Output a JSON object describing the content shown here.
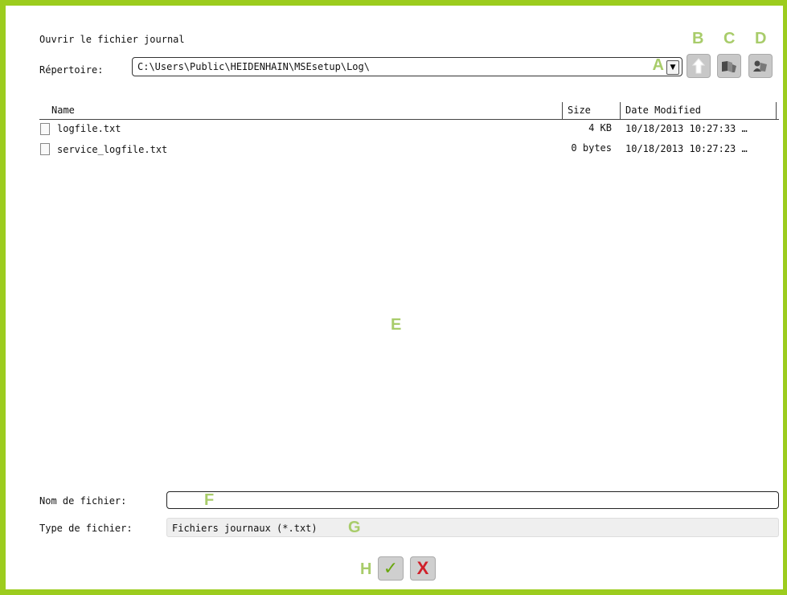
{
  "dialog": {
    "title": "Ouvrir le fichier journal",
    "directory_label": "Répertoire:",
    "directory_value": "C:\\Users\\Public\\HEIDENHAIN\\MSEsetup\\Log\\"
  },
  "callouts": {
    "a": "A",
    "b": "B",
    "c": "C",
    "d": "D",
    "e": "E",
    "f": "F",
    "g": "G",
    "h": "H"
  },
  "toolbar": {
    "icons": [
      "up-folder-icon",
      "browse-folder-icon",
      "network-folder-icon"
    ]
  },
  "file_list": {
    "headers": {
      "name": "Name",
      "size": "Size",
      "date": "Date Modified"
    },
    "rows": [
      {
        "name": "logfile.txt",
        "size": "4 KB",
        "date": "10/18/2013 10:27:33 …"
      },
      {
        "name": "service_logfile.txt",
        "size": "0 bytes",
        "date": "10/18/2013 10:27:23 …"
      }
    ]
  },
  "footer": {
    "filename_label": "Nom de fichier:",
    "filename_value": "",
    "filetype_label": "Type de fichier:",
    "filetype_value": "Fichiers journaux (*.txt)",
    "ok_symbol": "✓",
    "cancel_symbol": "X"
  },
  "colors": {
    "accent": "#9ccc1e",
    "callout": "#a8cc6a",
    "ok": "#6aa70f",
    "cancel": "#d0202a"
  }
}
